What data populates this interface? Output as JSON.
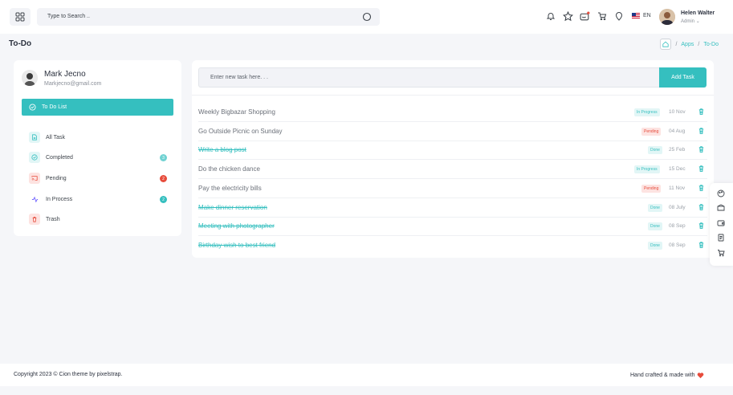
{
  "colors": {
    "accent": "#35bfbf",
    "danger": "#e74c3c",
    "purple": "#7366ff"
  },
  "header": {
    "search_placeholder": "Type to Search ..",
    "language": "EN",
    "user_name": "Helen Walter",
    "user_role": "Admin"
  },
  "page": {
    "title": "To-Do",
    "breadcrumb": [
      "Apps",
      "To-Do"
    ]
  },
  "profile": {
    "name": "Mark Jecno",
    "email": "Markjecno@gmail.com"
  },
  "sidebar": {
    "active_tab": "To Do List",
    "items": [
      {
        "label": "All Task",
        "icon": "file-icon",
        "badge": null
      },
      {
        "label": "Completed",
        "icon": "check-circle-icon",
        "badge": "3"
      },
      {
        "label": "Pending",
        "icon": "cast-icon",
        "badge": "2"
      },
      {
        "label": "In Process",
        "icon": "activity-icon",
        "badge": "2"
      },
      {
        "label": "Trash",
        "icon": "trash-icon",
        "badge": null
      }
    ]
  },
  "task_form": {
    "placeholder": "Enter new task here. . .",
    "add_label": "Add Task"
  },
  "tasks": [
    {
      "text": "Weekly Bigbazar Shopping",
      "status": "In Progress",
      "date": "10 Nov",
      "done": false
    },
    {
      "text": "Go Outside Picnic on Sunday",
      "status": "Pending",
      "date": "04 Aug",
      "done": false
    },
    {
      "text": "Write a blog post",
      "status": "Done",
      "date": "25 Feb",
      "done": true
    },
    {
      "text": "Do the chicken dance",
      "status": "In Progress",
      "date": "15 Dec",
      "done": false
    },
    {
      "text": "Pay the electricity bills",
      "status": "Pending",
      "date": "11 Nov",
      "done": false
    },
    {
      "text": "Make dinner reservation",
      "status": "Done",
      "date": "08 July",
      "done": true
    },
    {
      "text": "Meeting with photographer",
      "status": "Done",
      "date": "08 Sep",
      "done": true
    },
    {
      "text": "Birthday wish to best friend",
      "status": "Done",
      "date": "08 Sep",
      "done": true
    }
  ],
  "footer": {
    "copyright": "Copyright 2023 © Cion theme by pixelstrap.",
    "credit": "Hand crafted & made with"
  }
}
